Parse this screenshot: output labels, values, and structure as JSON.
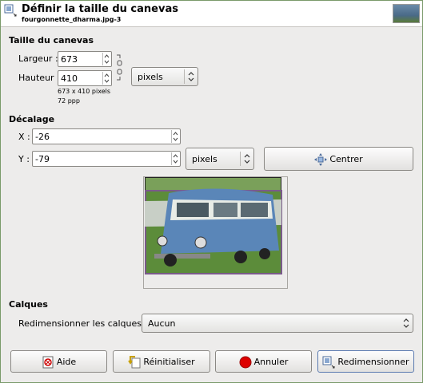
{
  "header": {
    "title": "Définir la taille du canevas",
    "subtitle": "fourgonnette_dharma.jpg-3"
  },
  "canvas_size": {
    "section_title": "Taille du canevas",
    "width_label": "Largeur :",
    "width_value": "673",
    "height_label": "Hauteur :",
    "height_value": "410",
    "unit": "pixels",
    "info_size": "673 x 410 pixels",
    "info_res": "72 ppp"
  },
  "offset": {
    "section_title": "Décalage",
    "x_label": "X :",
    "x_value": "-26",
    "y_label": "Y :",
    "y_value": "-79",
    "unit": "pixels",
    "center_label": "Centrer"
  },
  "layers": {
    "section_title": "Calques",
    "resize_label": "Redimensionner les calques :",
    "resize_value": "Aucun"
  },
  "buttons": {
    "help": "Aide",
    "reset": "Réinitialiser",
    "cancel": "Annuler",
    "resize": "Redimensionner"
  },
  "colors": {
    "cancel_icon": "#dd0000",
    "preview_border": "#7a5a8a"
  }
}
